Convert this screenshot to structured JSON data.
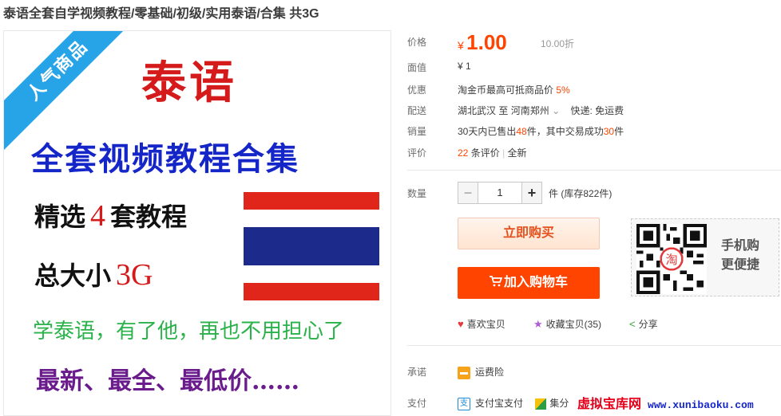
{
  "product": {
    "title": "泰语全套自学视频教程/零基础/初级/实用泰语/合集 共3G"
  },
  "poster": {
    "ribbon": "人气商品",
    "headline": "泰语",
    "subtitle": "全套视频教程合集",
    "line1_prefix": "精选",
    "line1_num": "4",
    "line1_suffix": "套教程",
    "line2_prefix": "总大小",
    "line2_num": "3G",
    "green_line": "学泰语，有了他，再也不用担心了",
    "purple_line": "最新、最全、最低价……"
  },
  "info": {
    "price_label": "价格",
    "currency": "¥",
    "price": "1.00",
    "discount": "10.00折",
    "face_label": "面值",
    "face_value": "¥ 1",
    "promo_label": "优惠",
    "promo_text": "淘金币最高可抵商品价",
    "promo_pct": "5%",
    "ship_label": "配送",
    "ship_from": "湖北武汉",
    "ship_to_word": "至",
    "ship_to": "河南郑州",
    "ship_caret": "⌄",
    "ship_method": "快递: 免运费",
    "sales_label": "销量",
    "sales_text1": "30天内已售出",
    "sales_num1": "48",
    "sales_text2": "件，其中交易成功",
    "sales_num2": "30",
    "sales_text3": "件",
    "review_label": "评价",
    "review_count": "22",
    "review_text": "条评价",
    "review_sep": "|",
    "review_new": "全新",
    "qty_label": "数量",
    "qty_value": "1",
    "qty_minus": "−",
    "qty_plus": "+",
    "qty_stock": "件 (库存822件)",
    "buy_now": "立即购买",
    "add_cart": "加入购物车",
    "mobile_line1": "手机购",
    "mobile_line2": "更便捷",
    "qr_center": "淘",
    "like": "喜欢宝贝",
    "fav": "收藏宝贝(35)",
    "share": "分享",
    "promise_label": "承诺",
    "promise_text": "运费险",
    "pay_label": "支付",
    "pay_alipay": "支付宝支付",
    "pay_jifen": "集分"
  },
  "icons": {
    "heart": "heart-icon",
    "star": "star-icon",
    "share": "share-icon",
    "cart": "cart-icon"
  },
  "watermark": {
    "text": "虚拟宝库网",
    "url": "www.xunibaoku.com"
  },
  "colors": {
    "accent": "#ff4400",
    "ribbon": "#27a3e8"
  }
}
